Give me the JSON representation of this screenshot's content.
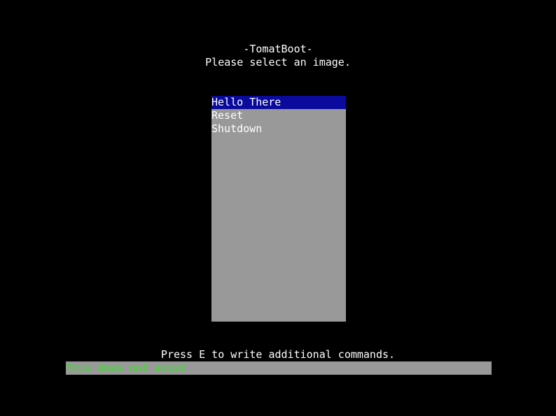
{
  "header": {
    "title": "-TomatBoot-",
    "prompt": "Please select an image."
  },
  "menu": {
    "items": [
      {
        "label": "Hello There",
        "selected": true
      },
      {
        "label": "Reset",
        "selected": false
      },
      {
        "label": "Shutdown",
        "selected": false
      }
    ]
  },
  "footer": {
    "hint": "Press E to write additional commands.",
    "command_text": "This does not exist"
  },
  "colors": {
    "background": "#000000",
    "panel": "#999999",
    "selection": "#0a0a9c",
    "text": "#ffffff",
    "command_text": "#3adf2a"
  }
}
